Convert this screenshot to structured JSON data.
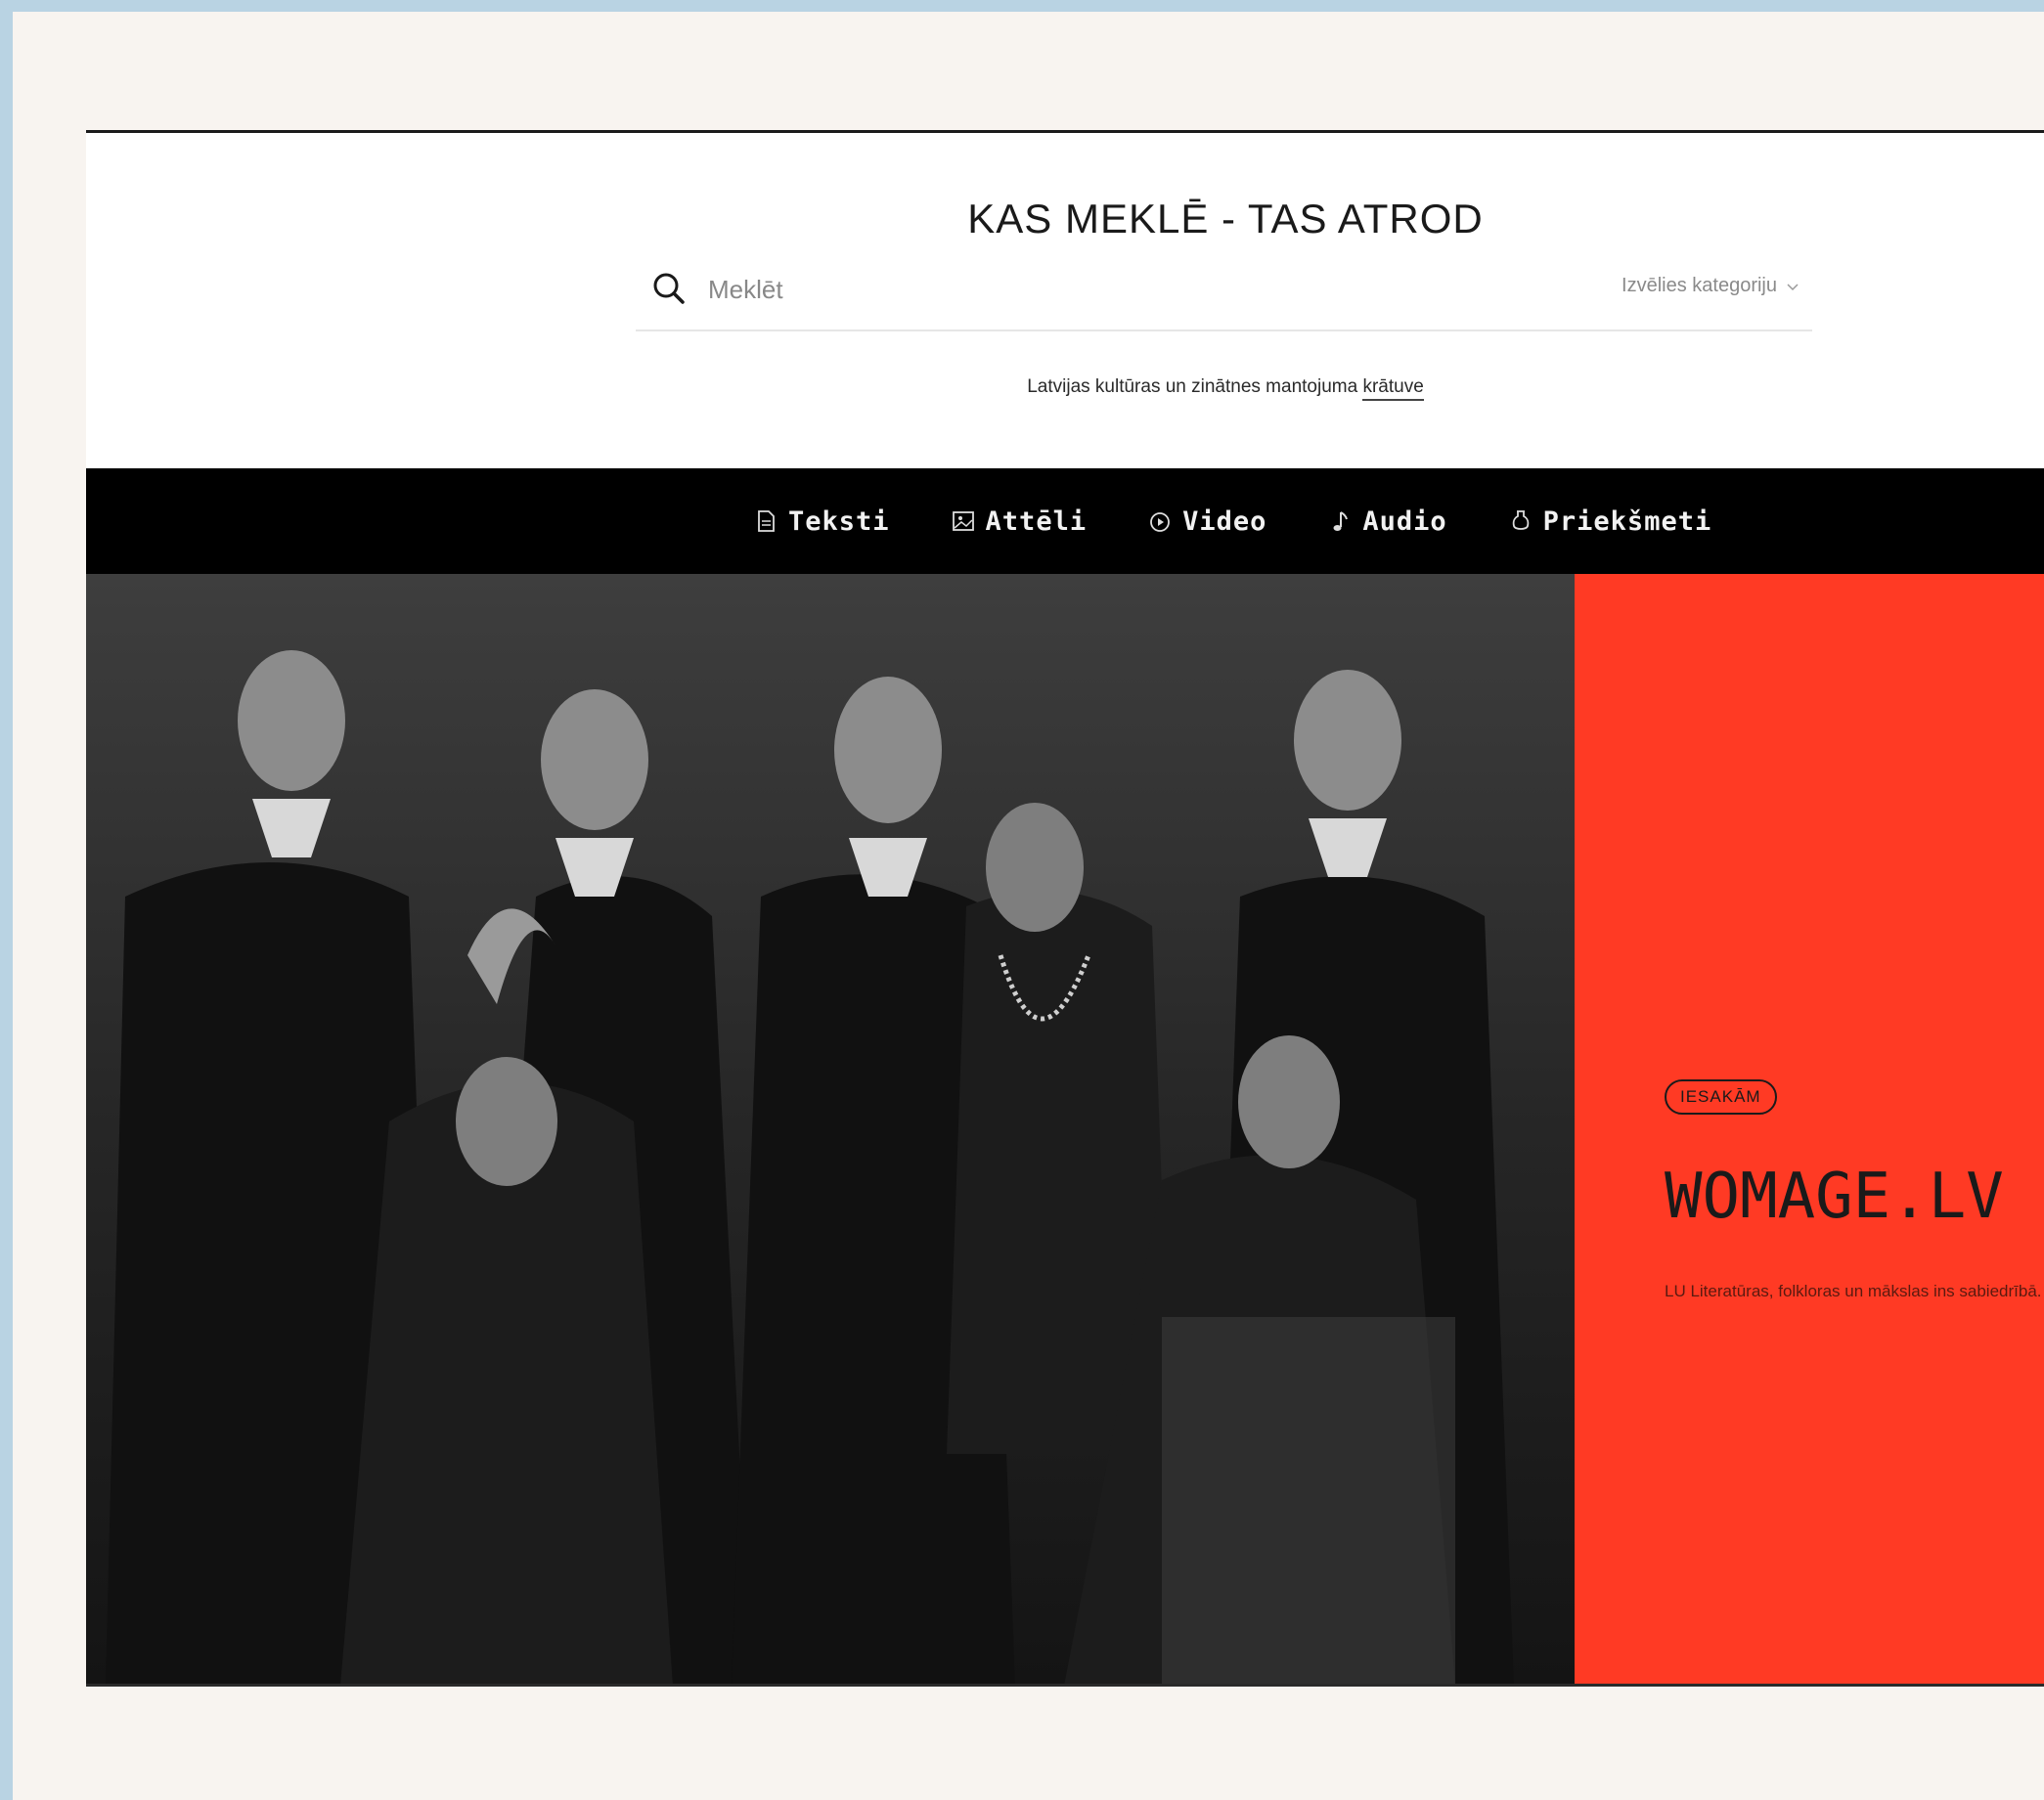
{
  "header": {
    "title": "KAS MEKLĒ - TAS ATROD"
  },
  "search": {
    "placeholder": "Meklēt",
    "category_label": "Izvēlies kategoriju"
  },
  "tagline": {
    "text": "Latvijas kultūras un zinātnes mantojuma ",
    "link": "krātuve"
  },
  "nav": {
    "items": [
      {
        "label": "Teksti",
        "icon": "document-icon"
      },
      {
        "label": "Attēli",
        "icon": "image-icon"
      },
      {
        "label": "Video",
        "icon": "play-circle-icon"
      },
      {
        "label": "Audio",
        "icon": "music-note-icon"
      },
      {
        "label": "Priekšmeti",
        "icon": "vase-icon"
      }
    ]
  },
  "feature": {
    "badge": "IESAKĀM",
    "title": "WOMAGE.LV",
    "description": "LU Literatūras, folkloras un mākslas ins sabiedrībā."
  },
  "colors": {
    "accent": "#ff3a24",
    "navbar": "#000000",
    "frame": "#b9d3e3"
  }
}
